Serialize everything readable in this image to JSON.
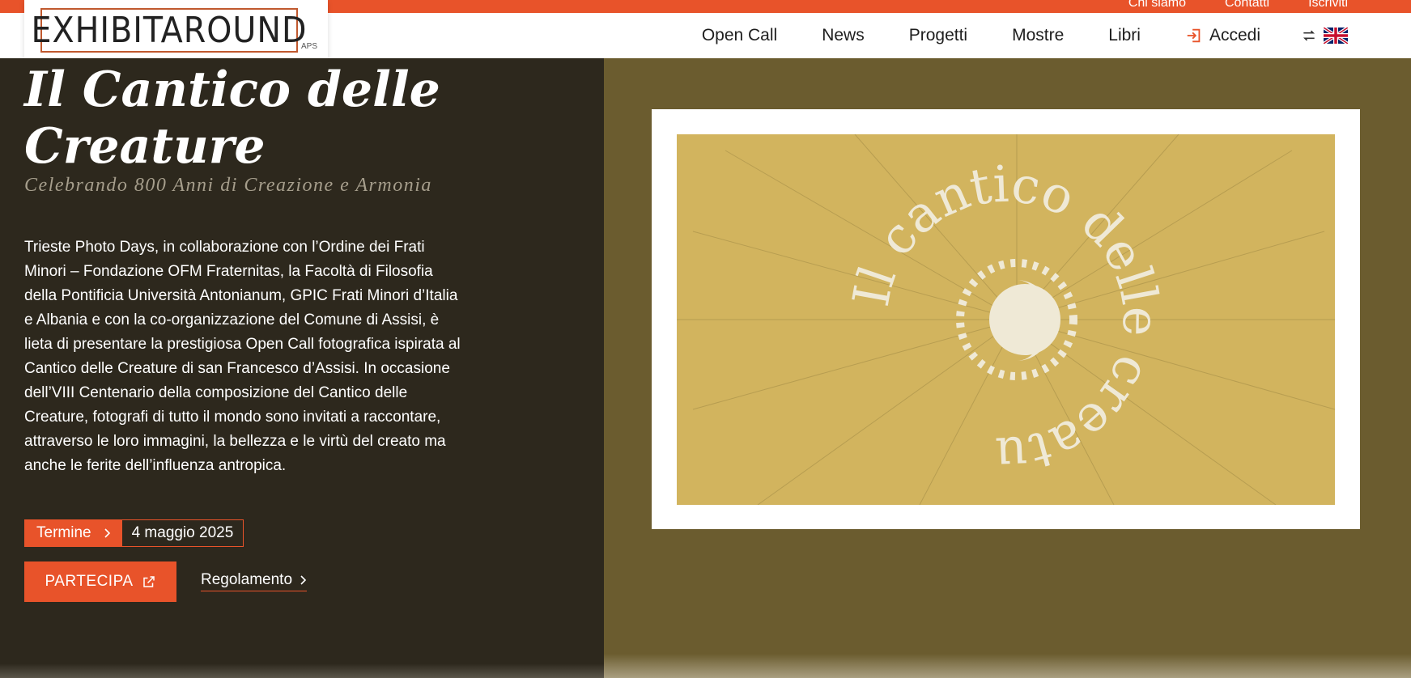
{
  "topbar": {
    "links": [
      "Chi siamo",
      "Contatti",
      "Iscriviti"
    ]
  },
  "brand": {
    "logo": "EXHIBITAROUND",
    "suffix": "APS"
  },
  "nav": {
    "items": [
      "Open Call",
      "News",
      "Progetti",
      "Mostre",
      "Libri"
    ],
    "login": "Accedi",
    "lang_icon": "swap-icon",
    "flag_icon": "uk-flag-icon"
  },
  "hero": {
    "title": "Il Cantico delle Creature",
    "subtitle": "Celebrando 800 Anni di Creazione e Armonia",
    "description": "Trieste Photo Days, in collaborazione con l’Ordine dei Frati Minori – Fondazione OFM Fraternitas, la Facoltà di Filosofia della Pontificia Università Antonianum, GPIC Frati Minori d’Italia e Albania e con la co-organizzazione del Comune di Assisi, è lieta di presentare la prestigiosa Open Call fotografica ispirata al Cantico delle Creature di san Francesco d’Assisi. In occasione dell’VIII Centenario della composizione del Cantico delle Creature, fotografi di tutto il mondo sono invitati a raccontare, attraverso le loro immagini, la bellezza e le virtù del creato ma anche le ferite dell’influenza antropica.",
    "deadline_label": "Termine",
    "deadline_value": "4 maggio 2025",
    "cta": "PARTECIPA",
    "rules_link": "Regolamento"
  },
  "artwork": {
    "text": "Il cantico delle creature"
  },
  "colors": {
    "accent": "#e8532a",
    "dark": "#2d281d",
    "olive": "#6b5c2f",
    "gold": "#d2b45e",
    "cream": "#efe9d6"
  }
}
